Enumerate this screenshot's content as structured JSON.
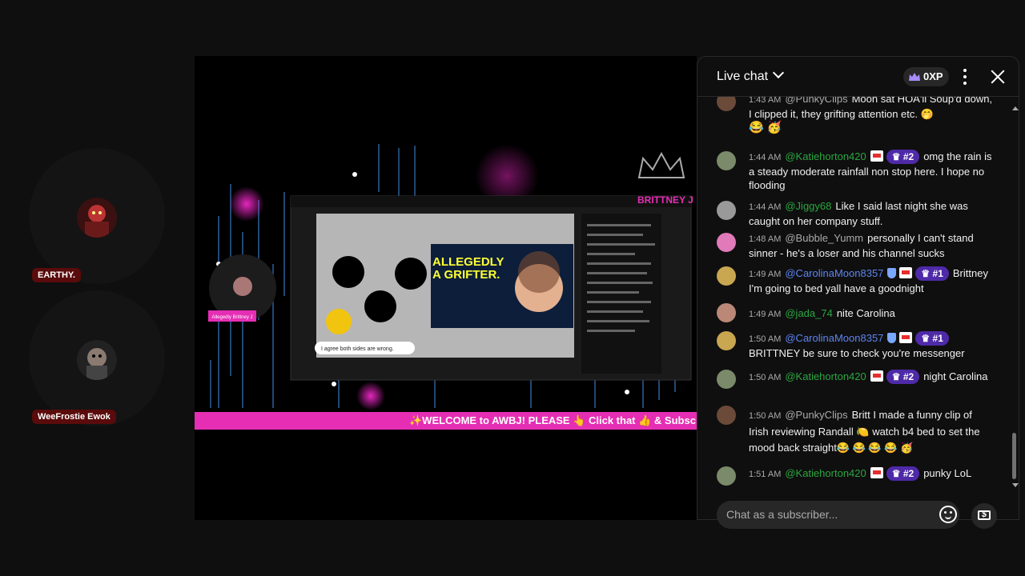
{
  "participants": [
    {
      "name": "EARTHY."
    },
    {
      "name": "WeeFrostie Ewok"
    }
  ],
  "stream": {
    "ticker_text": "✨WELCOME to AWBJ! PLEASE 👆 Click that 👍 & Subsc",
    "inner_title": "ALLEGEDLY A GRIFTER.",
    "inner_caption": "I agree both sides are wrong.",
    "inner_tag": "Allegedly Brittney J",
    "brand": "BRITTNEY J"
  },
  "chat": {
    "title": "Live chat",
    "xp": "0XP",
    "input_placeholder": "Chat as a subscriber...",
    "colors": {
      "member": "#2ba640",
      "rank_bg": "#4e2aa8",
      "ticker": "#e52eb4"
    },
    "messages": [
      {
        "time": "1:43 AM",
        "author": "@PunkyClips",
        "type": "normal",
        "rank": "",
        "text": "Moon sat HOA'll Soup'd down, I clipped it, they grifting attention etc. 🤭",
        "extra": "😂 🥳"
      },
      {
        "time": "1:44 AM",
        "author": "@Katiehorton420",
        "type": "member",
        "rank": "#2",
        "text": "omg the rain is a steady moderate rainfall non stop here. I hope no flooding",
        "extra": ""
      },
      {
        "time": "1:44 AM",
        "author": "@Jiggy68",
        "type": "member",
        "rank": "",
        "text": "Like I said last night she was caught on her company stuff.",
        "extra": ""
      },
      {
        "time": "1:48 AM",
        "author": "@Bubble_Yumm",
        "type": "normal",
        "rank": "",
        "text": "personally I can't stand sinner - he's a loser and his channel sucks",
        "extra": ""
      },
      {
        "time": "1:49 AM",
        "author": "@CarolinaMoon8357",
        "type": "mod",
        "rank": "#1",
        "text": "Brittney I'm going to bed yall have a goodnight",
        "extra": ""
      },
      {
        "time": "1:49 AM",
        "author": "@jada_74",
        "type": "member",
        "rank": "",
        "text": "nite Carolina",
        "extra": ""
      },
      {
        "time": "1:50 AM",
        "author": "@CarolinaMoon8357",
        "type": "mod",
        "rank": "#1",
        "text": "BRITTNEY be sure to check you're messenger",
        "extra": ""
      },
      {
        "time": "1:50 AM",
        "author": "@Katiehorton420",
        "type": "member",
        "rank": "#2",
        "text": "night Carolina",
        "extra": ""
      },
      {
        "time": "1:50 AM",
        "author": "@PunkyClips",
        "type": "normal",
        "rank": "",
        "text": "Britt I made a funny clip of Irish reviewing Randall 🍋 watch b4 bed to set the mood back straight😂 😂 😂 😂 🥳",
        "extra": ""
      },
      {
        "time": "1:51 AM",
        "author": "@Katiehorton420",
        "type": "member",
        "rank": "#2",
        "text": "punky LoL",
        "extra": ""
      }
    ]
  }
}
